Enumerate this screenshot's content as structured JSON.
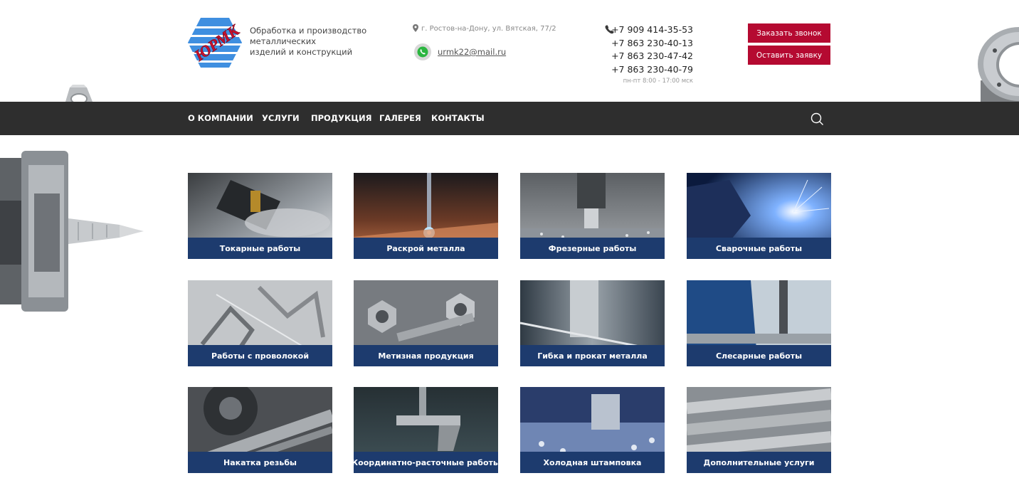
{
  "header": {
    "logo_text": "ЮРМК",
    "tagline": [
      "Обработка и производство",
      "металлических",
      "изделий и конструкций"
    ],
    "address": "г. Ростов-на-Дону, ул. Вятская, 77/2",
    "email": "urmk22@mail.ru",
    "phones": [
      "+7 909 414-35-53",
      "+7 863 230-40-13",
      "+7 863 230-47-42",
      "+7 863 230-40-79"
    ],
    "hours": "пн-пт 8:00 - 17:00 мск",
    "call_button": "Заказать звонок",
    "request_button": "Оставить заявку"
  },
  "nav": {
    "items": [
      "О КОМПАНИИ",
      "УСЛУГИ",
      "ПРОДУКЦИЯ",
      "ГАЛЕРЕЯ",
      "КОНТАКТЫ"
    ]
  },
  "services": [
    "Токарные работы",
    "Раскрой металла",
    "Фрезерные работы",
    "Сварочные работы",
    "Работы с проволокой",
    "Метизная продукция",
    "Гибка и прокат металла",
    "Слесарные работы",
    "Накатка резьбы",
    "Координатно-расточные работы",
    "Холодная штамповка",
    "Дополнительные услуги"
  ],
  "colors": {
    "accent": "#b50a31",
    "nav_bg": "#2e2e2e",
    "caption_bg": "#1d3b6e",
    "logo_blue": "#3f8fe0",
    "logo_red": "#c8102e"
  },
  "icons": {
    "address": "map-pin-icon",
    "email": "whatsapp-icon",
    "phone": "phone-icon",
    "search": "search-icon"
  }
}
